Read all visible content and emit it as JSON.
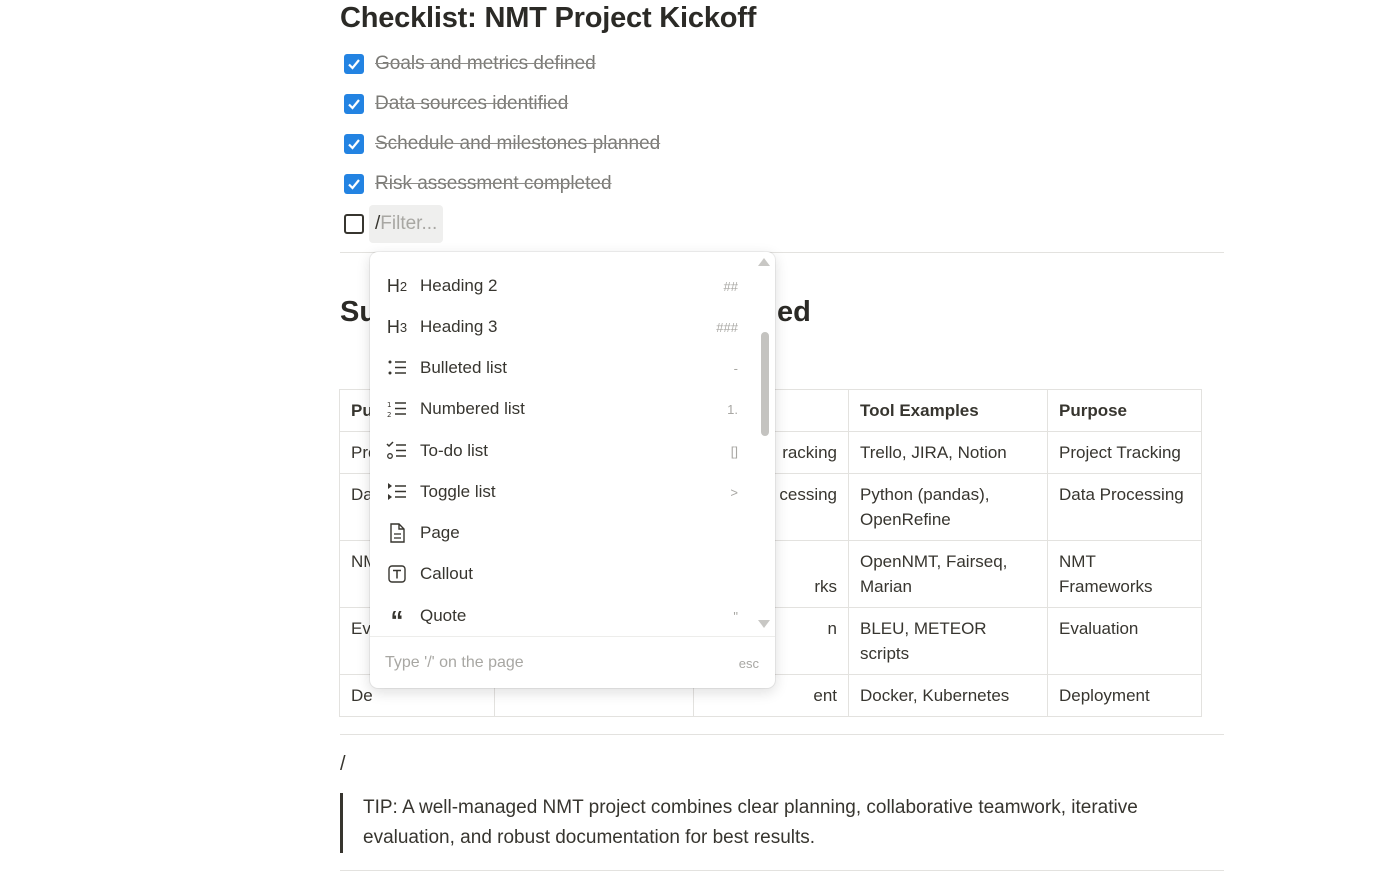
{
  "checklist": {
    "title": "Checklist: NMT Project Kickoff",
    "items": [
      {
        "label": "Goals and metrics defined",
        "checked": true
      },
      {
        "label": "Data sources identified",
        "checked": true
      },
      {
        "label": "Schedule and milestones planned",
        "checked": true
      },
      {
        "label": "Risk assessment completed",
        "checked": true
      }
    ],
    "new_item": {
      "slash": "/",
      "placeholder": "Filter..."
    }
  },
  "section": {
    "heading_start": "Su",
    "heading_end": "ed"
  },
  "table": {
    "headers": [
      "Pu",
      "",
      "",
      "Tool Examples",
      "Purpose"
    ],
    "rows": [
      [
        "Pro",
        "",
        "racking",
        "Trello, JIRA, Notion",
        "Project Tracking"
      ],
      [
        "Da",
        "",
        "cessing",
        "Python (pandas), OpenRefine",
        "Data Processing"
      ],
      [
        "NM Fra",
        "",
        "rks",
        "OpenNMT, Fairseq, Marian",
        "NMT Frameworks"
      ],
      [
        "Eva",
        "",
        "n",
        "BLEU, METEOR scripts",
        "Evaluation"
      ],
      [
        "De",
        "",
        "ent",
        "Docker, Kubernetes",
        "Deployment"
      ]
    ]
  },
  "slash_line": "/",
  "tip": "TIP: A well-managed NMT project combines clear planning, collaborative teamwork, iterative evaluation, and robust documentation for best results.",
  "menu": {
    "items": [
      {
        "icon": "heading-2-icon",
        "label": "Heading 2",
        "shortcut": "##"
      },
      {
        "icon": "heading-3-icon",
        "label": "Heading 3",
        "shortcut": "###"
      },
      {
        "icon": "bulleted-list-icon",
        "label": "Bulleted list",
        "shortcut": "-"
      },
      {
        "icon": "numbered-list-icon",
        "label": "Numbered list",
        "shortcut": "1."
      },
      {
        "icon": "todo-list-icon",
        "label": "To-do list",
        "shortcut": "[]"
      },
      {
        "icon": "toggle-list-icon",
        "label": "Toggle list",
        "shortcut": ">"
      },
      {
        "icon": "page-icon",
        "label": "Page",
        "shortcut": ""
      },
      {
        "icon": "callout-icon",
        "label": "Callout",
        "shortcut": ""
      },
      {
        "icon": "quote-icon",
        "label": "Quote",
        "shortcut": "\""
      }
    ],
    "footer": "Type '/' on the page",
    "esc": "esc"
  },
  "colors": {
    "accent": "#2383e2",
    "text": "#37352f",
    "muted": "#a8a7a3"
  }
}
